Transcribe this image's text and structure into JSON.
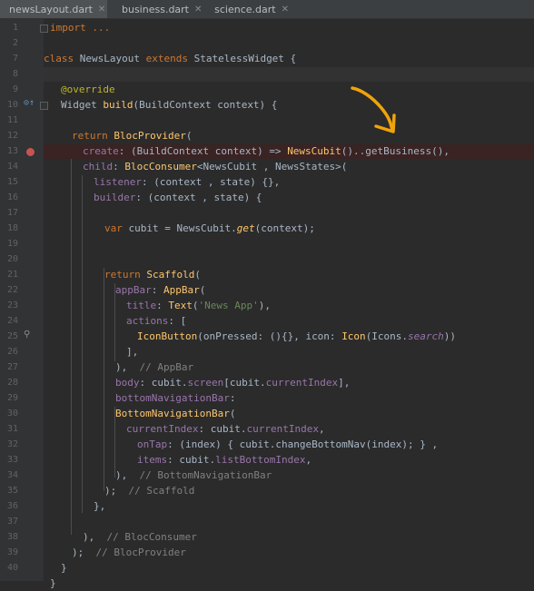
{
  "tabs": [
    {
      "label": "newsLayout.dart",
      "active": true
    },
    {
      "label": "business.dart",
      "active": false
    },
    {
      "label": "science.dart",
      "active": false
    }
  ],
  "colors": {
    "accent_arrow": "#f0a30a",
    "breakpoint": "#c75450"
  },
  "line_numbers": [
    "1",
    "2",
    "7",
    "8",
    "9",
    "10",
    "11",
    "12",
    "13",
    "14",
    "15",
    "16",
    "17",
    "18",
    "19",
    "20",
    "21",
    "22",
    "23",
    "24",
    "25",
    "26",
    "27",
    "28",
    "29",
    "30",
    "31",
    "32",
    "33",
    "34",
    "35",
    "36",
    "37",
    "38",
    "39",
    "40"
  ],
  "code": {
    "l1": "import ...",
    "l7_a": "class ",
    "l7_b": "NewsLayout ",
    "l7_c": "extends ",
    "l7_d": "StatelessWidget {",
    "l9": "@override",
    "l10_a": "Widget ",
    "l10_b": "build",
    "l10_c": "(BuildContext context) {",
    "l12_a": "return ",
    "l12_b": "BlocProvider",
    "l12_c": "(",
    "l13_a": "create",
    "l13_b": ": (BuildContext context) => ",
    "l13_c": "NewsCubit",
    "l13_d": "()..getBusiness(),",
    "l14_a": "child",
    "l14_b": ": ",
    "l14_c": "BlocConsumer",
    "l14_d": "<NewsCubit , NewsStates>(",
    "l15_a": "listener",
    "l15_b": ": (context , state) {},",
    "l16_a": "builder",
    "l16_b": ": (context , state) {",
    "l18_a": "var ",
    "l18_b": "cubit = NewsCubit.",
    "l18_c": "get",
    "l18_d": "(context);",
    "l21_a": "return ",
    "l21_b": "Scaffold",
    "l21_c": "(",
    "l22_a": "appBar",
    "l22_b": ": ",
    "l22_c": "AppBar",
    "l22_d": "(",
    "l23_a": "title",
    "l23_b": ": ",
    "l23_c": "Text",
    "l23_d": "(",
    "l23_e": "'News App'",
    "l23_f": "),",
    "l24_a": "actions",
    "l24_b": ": [",
    "l25_a": "IconButton",
    "l25_b": "(onPressed: (){}, icon: ",
    "l25_c": "Icon",
    "l25_d": "(Icons.",
    "l25_e": "search",
    "l25_f": "))",
    "l26": "],",
    "l27_a": "),  ",
    "l27_b": "// AppBar",
    "l28_a": "body",
    "l28_b": ": cubit.",
    "l28_c": "screen",
    "l28_d": "[cubit.",
    "l28_e": "currentIndex",
    "l28_f": "],",
    "l29_a": "bottomNavigationBar",
    "l29_b": ":",
    "l30_a": "BottomNavigationBar",
    "l30_b": "(",
    "l31_a": "currentIndex",
    "l31_b": ": cubit.",
    "l31_c": "currentIndex",
    "l31_d": ",",
    "l32_a": "onTap",
    "l32_b": ": (index) { cubit.changeBottomNav(index); } ,",
    "l33_a": "items",
    "l33_b": ": cubit.",
    "l33_c": "listBottomIndex",
    "l33_d": ",",
    "l34_a": "),  ",
    "l34_b": "// BottomNavigationBar",
    "l35_a": ");  ",
    "l35_b": "// Scaffold",
    "l36": "},",
    "l38_a": "),  ",
    "l38_b": "// BlocConsumer",
    "l39_a": ");  ",
    "l39_b": "// BlocProvider",
    "l40": "}",
    "l41": "}"
  }
}
